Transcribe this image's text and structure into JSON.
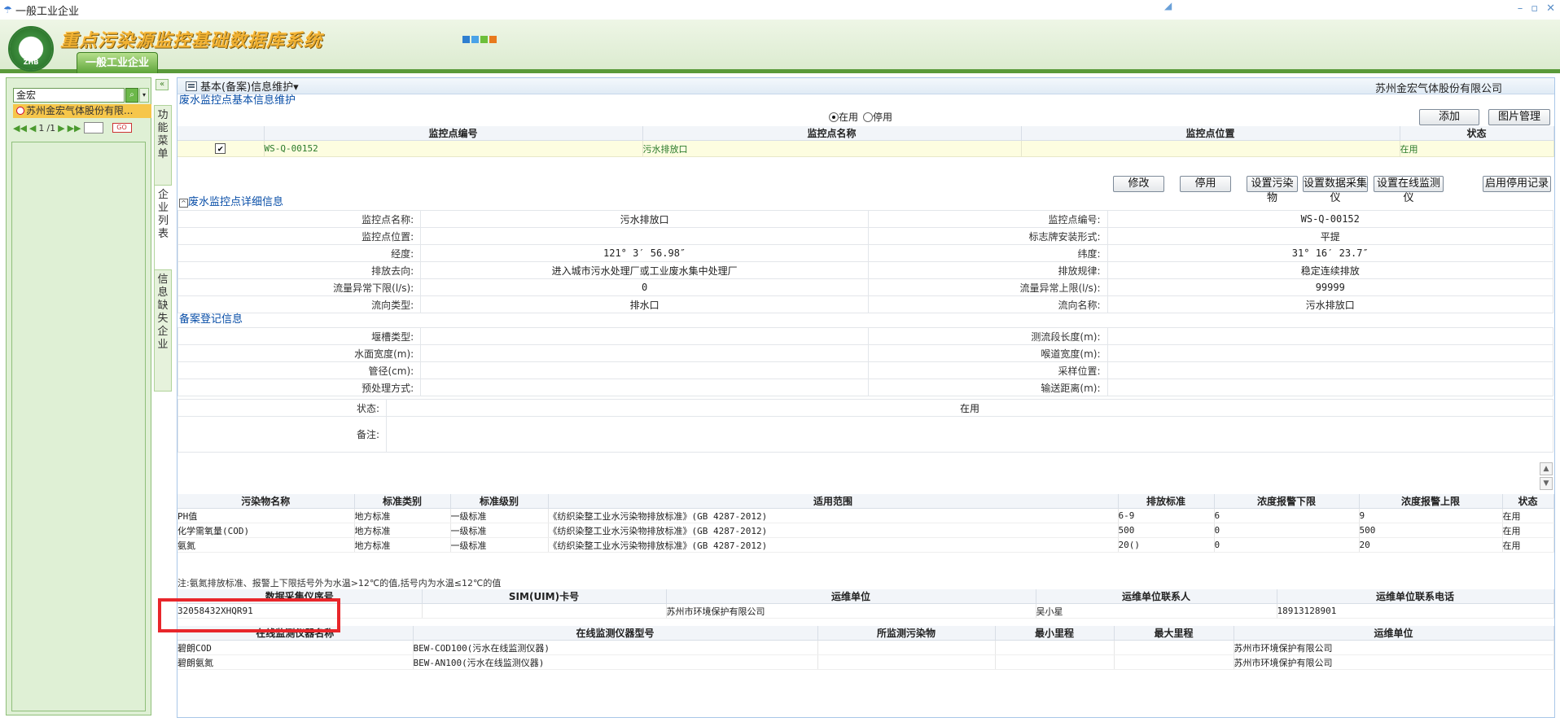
{
  "window": {
    "title": "一般工业企业",
    "min_icon": "minimize-icon",
    "max_icon": "restore-icon",
    "close_icon": "close-icon"
  },
  "banner": {
    "logo_text": "ZHB",
    "system_title": "重点污染源监控基础数据库系统",
    "nav_tab": "一般工业企业",
    "skin_colors": [
      "#2f7fd0",
      "#4aa3e8",
      "#6cbf3a",
      "#e87a1e"
    ]
  },
  "left_panel": {
    "search_value": "金宏",
    "list_items": [
      "苏州金宏气体股份有限..."
    ],
    "pager": {
      "current": "1",
      "total": "/1"
    }
  },
  "vertical_tabs": [
    "功能菜单",
    "企业列表",
    "信息缺失企业"
  ],
  "main": {
    "header_title": "基本(备案)信息维护▾",
    "company": "苏州金宏气体股份有限公司",
    "section1_title": "废水监控点基本信息维护",
    "status_filter": {
      "active": "在用",
      "inactive": "停用",
      "selected": "在用"
    },
    "buttons_top": {
      "add": "添加",
      "image_manage": "图片管理"
    },
    "points_table": {
      "headers": [
        "",
        "监控点编号",
        "监控点名称",
        "监控点位置",
        "状态"
      ],
      "rows": [
        {
          "code": "WS-Q-00152",
          "name": "污水排放口",
          "location": "",
          "status": "在用"
        }
      ]
    },
    "action_buttons": [
      "修改",
      "停用",
      "设置污染物",
      "设置数据采集仪",
      "设置在线监测仪",
      "启用停用记录"
    ],
    "detail_title": "废水监控点详细信息",
    "detail": [
      {
        "l1": "监控点名称:",
        "v1": "污水排放口",
        "l2": "监控点编号:",
        "v2": "WS-Q-00152"
      },
      {
        "l1": "监控点位置:",
        "v1": "",
        "l2": "标志牌安装形式:",
        "v2": "平提"
      },
      {
        "l1": "经度:",
        "v1": "121° 3′ 56.98″",
        "l2": "纬度:",
        "v2": "31° 16′ 23.7″"
      },
      {
        "l1": "排放去向:",
        "v1": "进入城市污水处理厂或工业废水集中处理厂",
        "l2": "排放规律:",
        "v2": "稳定连续排放"
      },
      {
        "l1": "流量异常下限(l/s):",
        "v1": "0",
        "l2": "流量异常上限(l/s):",
        "v2": "99999"
      },
      {
        "l1": "流向类型:",
        "v1": "排水口",
        "l2": "流向名称:",
        "v2": "污水排放口"
      }
    ],
    "filing_title": "备案登记信息",
    "filing": [
      {
        "l1": "堰槽类型:",
        "v1": "",
        "l2": "测流段长度(m):",
        "v2": ""
      },
      {
        "l1": "水面宽度(m):",
        "v1": "",
        "l2": "喉道宽度(m):",
        "v2": ""
      },
      {
        "l1": "管径(cm):",
        "v1": "",
        "l2": "采样位置:",
        "v2": ""
      },
      {
        "l1": "预处理方式:",
        "v1": "",
        "l2": "输送距离(m):",
        "v2": ""
      }
    ],
    "status_row": {
      "label": "状态:",
      "value": "在用"
    },
    "remark_row": {
      "label": "备注:",
      "value": ""
    },
    "pollutant_table": {
      "headers": [
        "污染物名称",
        "标准类别",
        "标准级别",
        "适用范围",
        "排放标准",
        "浓度报警下限",
        "浓度报警上限",
        "状态"
      ],
      "rows": [
        [
          "PH值",
          "地方标准",
          "一级标准",
          "《纺织染整工业水污染物排放标准》(GB 4287-2012)",
          "6-9",
          "6",
          "9",
          "在用"
        ],
        [
          "化学需氧量(COD)",
          "地方标准",
          "一级标准",
          "《纺织染整工业水污染物排放标准》(GB 4287-2012)",
          "500",
          "0",
          "500",
          "在用"
        ],
        [
          "氨氮",
          "地方标准",
          "一级标准",
          "《纺织染整工业水污染物排放标准》(GB 4287-2012)",
          "20()",
          "0",
          "20",
          "在用"
        ]
      ],
      "note": "注:氨氮排放标准、报警上下限括号外为水温>12℃的值,括号内为水温≤12℃的值"
    },
    "collector_table": {
      "headers": [
        "数据采集仪序号",
        "SIM(UIM)卡号",
        "运维单位",
        "运维单位联系人",
        "运维单位联系电话"
      ],
      "rows": [
        [
          "32058432XHQR91",
          "",
          "苏州市环境保护有限公司",
          "吴小星",
          "18913128901"
        ]
      ]
    },
    "monitor_table": {
      "headers": [
        "在线监测仪器名称",
        "在线监测仪器型号",
        "所监测污染物",
        "最小里程",
        "最大里程",
        "运维单位"
      ],
      "rows": [
        [
          "碧朗COD",
          "BEW-COD100(污水在线监测仪器)",
          "",
          "",
          "",
          "苏州市环境保护有限公司"
        ],
        [
          "碧朗氨氮",
          "BEW-AN100(污水在线监测仪器)",
          "",
          "",
          "",
          "苏州市环境保护有限公司"
        ]
      ]
    }
  }
}
